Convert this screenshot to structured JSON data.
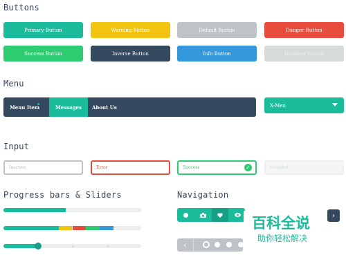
{
  "sections": {
    "buttons": "Buttons",
    "menu": "Menu",
    "input": "Input",
    "progress": "Progress bars & Sliders",
    "navigation": "Navigation"
  },
  "buttons": {
    "primary": "Primary Button",
    "warning": "Warning Button",
    "default": "Default Button",
    "danger": "Danger Button",
    "success": "Success Button",
    "inverse": "Inverse Button",
    "info": "Info Button",
    "disabled": "Disabled Button"
  },
  "menu": {
    "item": "Menu Item",
    "messages": "Messages",
    "about": "About Us",
    "select_value": "X-Men"
  },
  "inputs": {
    "inactive": "Inactive",
    "error": "Error",
    "success": "Success",
    "disabled": "Disabled"
  },
  "progress": {
    "bar1": 0.45,
    "bar2_segments": [
      0.4,
      0.1,
      0.1,
      0.1,
      0.1
    ],
    "slider_value": 0.25
  },
  "navigation": {
    "icons": [
      "circle-icon",
      "camera-icon",
      "heart-icon",
      "eye-icon"
    ],
    "pagination_dots": 5
  },
  "watermark": {
    "title": "百科全说",
    "subtitle": "助你轻松解决"
  },
  "colors": {
    "turquoise": "#1abc9c",
    "warning": "#f1c40f",
    "default": "#bdc3c7",
    "danger": "#e74c3c",
    "success": "#2ecc71",
    "inverse": "#34495e",
    "info": "#3498db",
    "disabled": "#d5dbdb"
  }
}
